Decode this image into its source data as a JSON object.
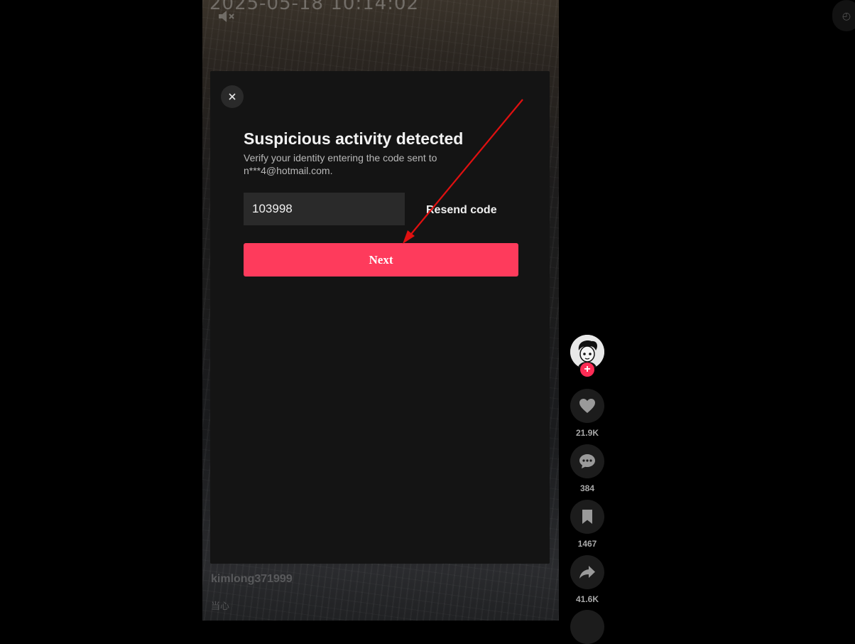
{
  "video": {
    "timestamp": "2025-05-18 10:14:02",
    "username": "kimlong371999",
    "caption": "当心"
  },
  "modal": {
    "title": "Suspicious activity detected",
    "subtitle": "Verify your identity entering the code sent to n***4@hotmail.com.",
    "code_value": "103998",
    "resend_label": "Resend code",
    "next_label": "Next"
  },
  "rail": {
    "likes": "21.9K",
    "comments": "384",
    "saves": "1467",
    "shares": "41.6K"
  },
  "colors": {
    "accent": "#fe3b5c",
    "modal_bg": "#141414",
    "annotation_arrow": "#e01010"
  }
}
